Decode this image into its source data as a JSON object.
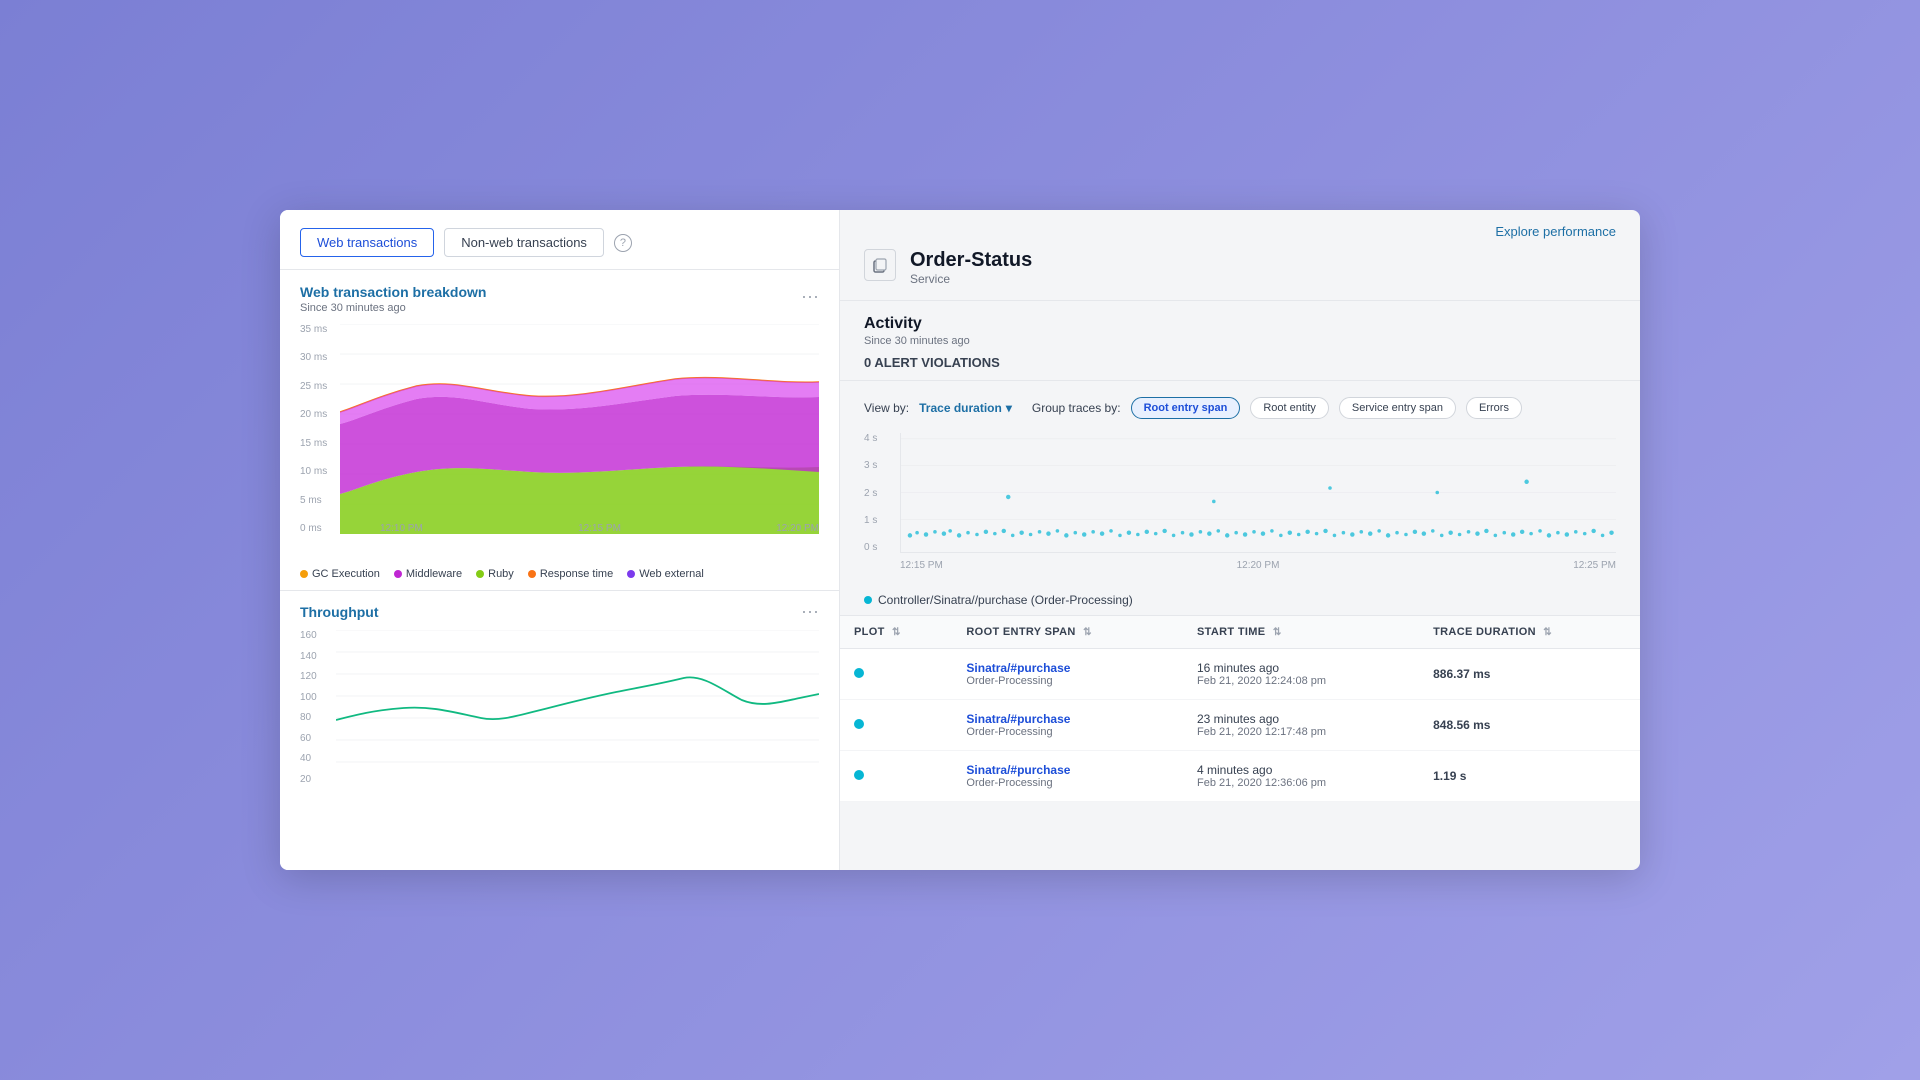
{
  "tabs": {
    "web": "Web transactions",
    "non_web": "Non-web transactions"
  },
  "breakdown_chart": {
    "title": "Web transaction breakdown",
    "subtitle": "Since 30 minutes ago",
    "options": "...",
    "y_labels": [
      "35 ms",
      "30 ms",
      "25 ms",
      "20 ms",
      "15 ms",
      "10 ms",
      "5 ms",
      "0 ms"
    ],
    "x_labels": [
      "12:10 PM",
      "12:15 PM",
      "12:20 PM"
    ]
  },
  "legend": [
    {
      "label": "GC Execution",
      "color": "#f59e0b"
    },
    {
      "label": "Middleware",
      "color": "#c026d3"
    },
    {
      "label": "Ruby",
      "color": "#84cc16"
    },
    {
      "label": "Response time",
      "color": "#f97316"
    },
    {
      "label": "Web external",
      "color": "#7c3aed"
    }
  ],
  "throughput": {
    "title": "Throughput",
    "options": "...",
    "y_labels": [
      "160",
      "140",
      "120",
      "100",
      "80",
      "60",
      "40",
      "20"
    ]
  },
  "service": {
    "name": "Order-Status",
    "type": "Service"
  },
  "activity": {
    "title": "Activity",
    "subtitle": "Since 30 minutes ago",
    "alert_violations": "0 ALERT VIOLATIONS"
  },
  "explore_btn": "Explore performance",
  "traces": {
    "view_by_label": "View by:",
    "view_by_value": "Trace duration",
    "group_by_label": "Group traces by:",
    "group_buttons": [
      "Root entry span",
      "Root entity",
      "Service entry span",
      "Errors"
    ],
    "scatter_y_labels": [
      "4 s",
      "3 s",
      "2 s",
      "1 s",
      "0 s"
    ],
    "scatter_x_labels": [
      "12:15 PM",
      "12:20 PM",
      "12:25 PM"
    ],
    "filter_label": "Controller/Sinatra//purchase (Order-Processing)",
    "table_headers": [
      {
        "label": "PLOT",
        "sortable": true
      },
      {
        "label": "ROOT ENTRY SPAN",
        "sortable": true
      },
      {
        "label": "START TIME",
        "sortable": true
      },
      {
        "label": "TRACE DURATION",
        "sortable": true
      }
    ],
    "rows": [
      {
        "span_name": "Sinatra/#purchase",
        "span_sub": "Order-Processing",
        "start_time": "16 minutes ago",
        "start_date": "Feb 21, 2020 12:24:08 pm",
        "duration": "886.37 ms"
      },
      {
        "span_name": "Sinatra/#purchase",
        "span_sub": "Order-Processing",
        "start_time": "23 minutes ago",
        "start_date": "Feb 21, 2020 12:17:48 pm",
        "duration": "848.56 ms"
      },
      {
        "span_name": "Sinatra/#purchase",
        "span_sub": "Order-Processing",
        "start_time": "4 minutes ago",
        "start_date": "Feb 21, 2020 12:36:06 pm",
        "duration": "1.19 s"
      }
    ]
  }
}
